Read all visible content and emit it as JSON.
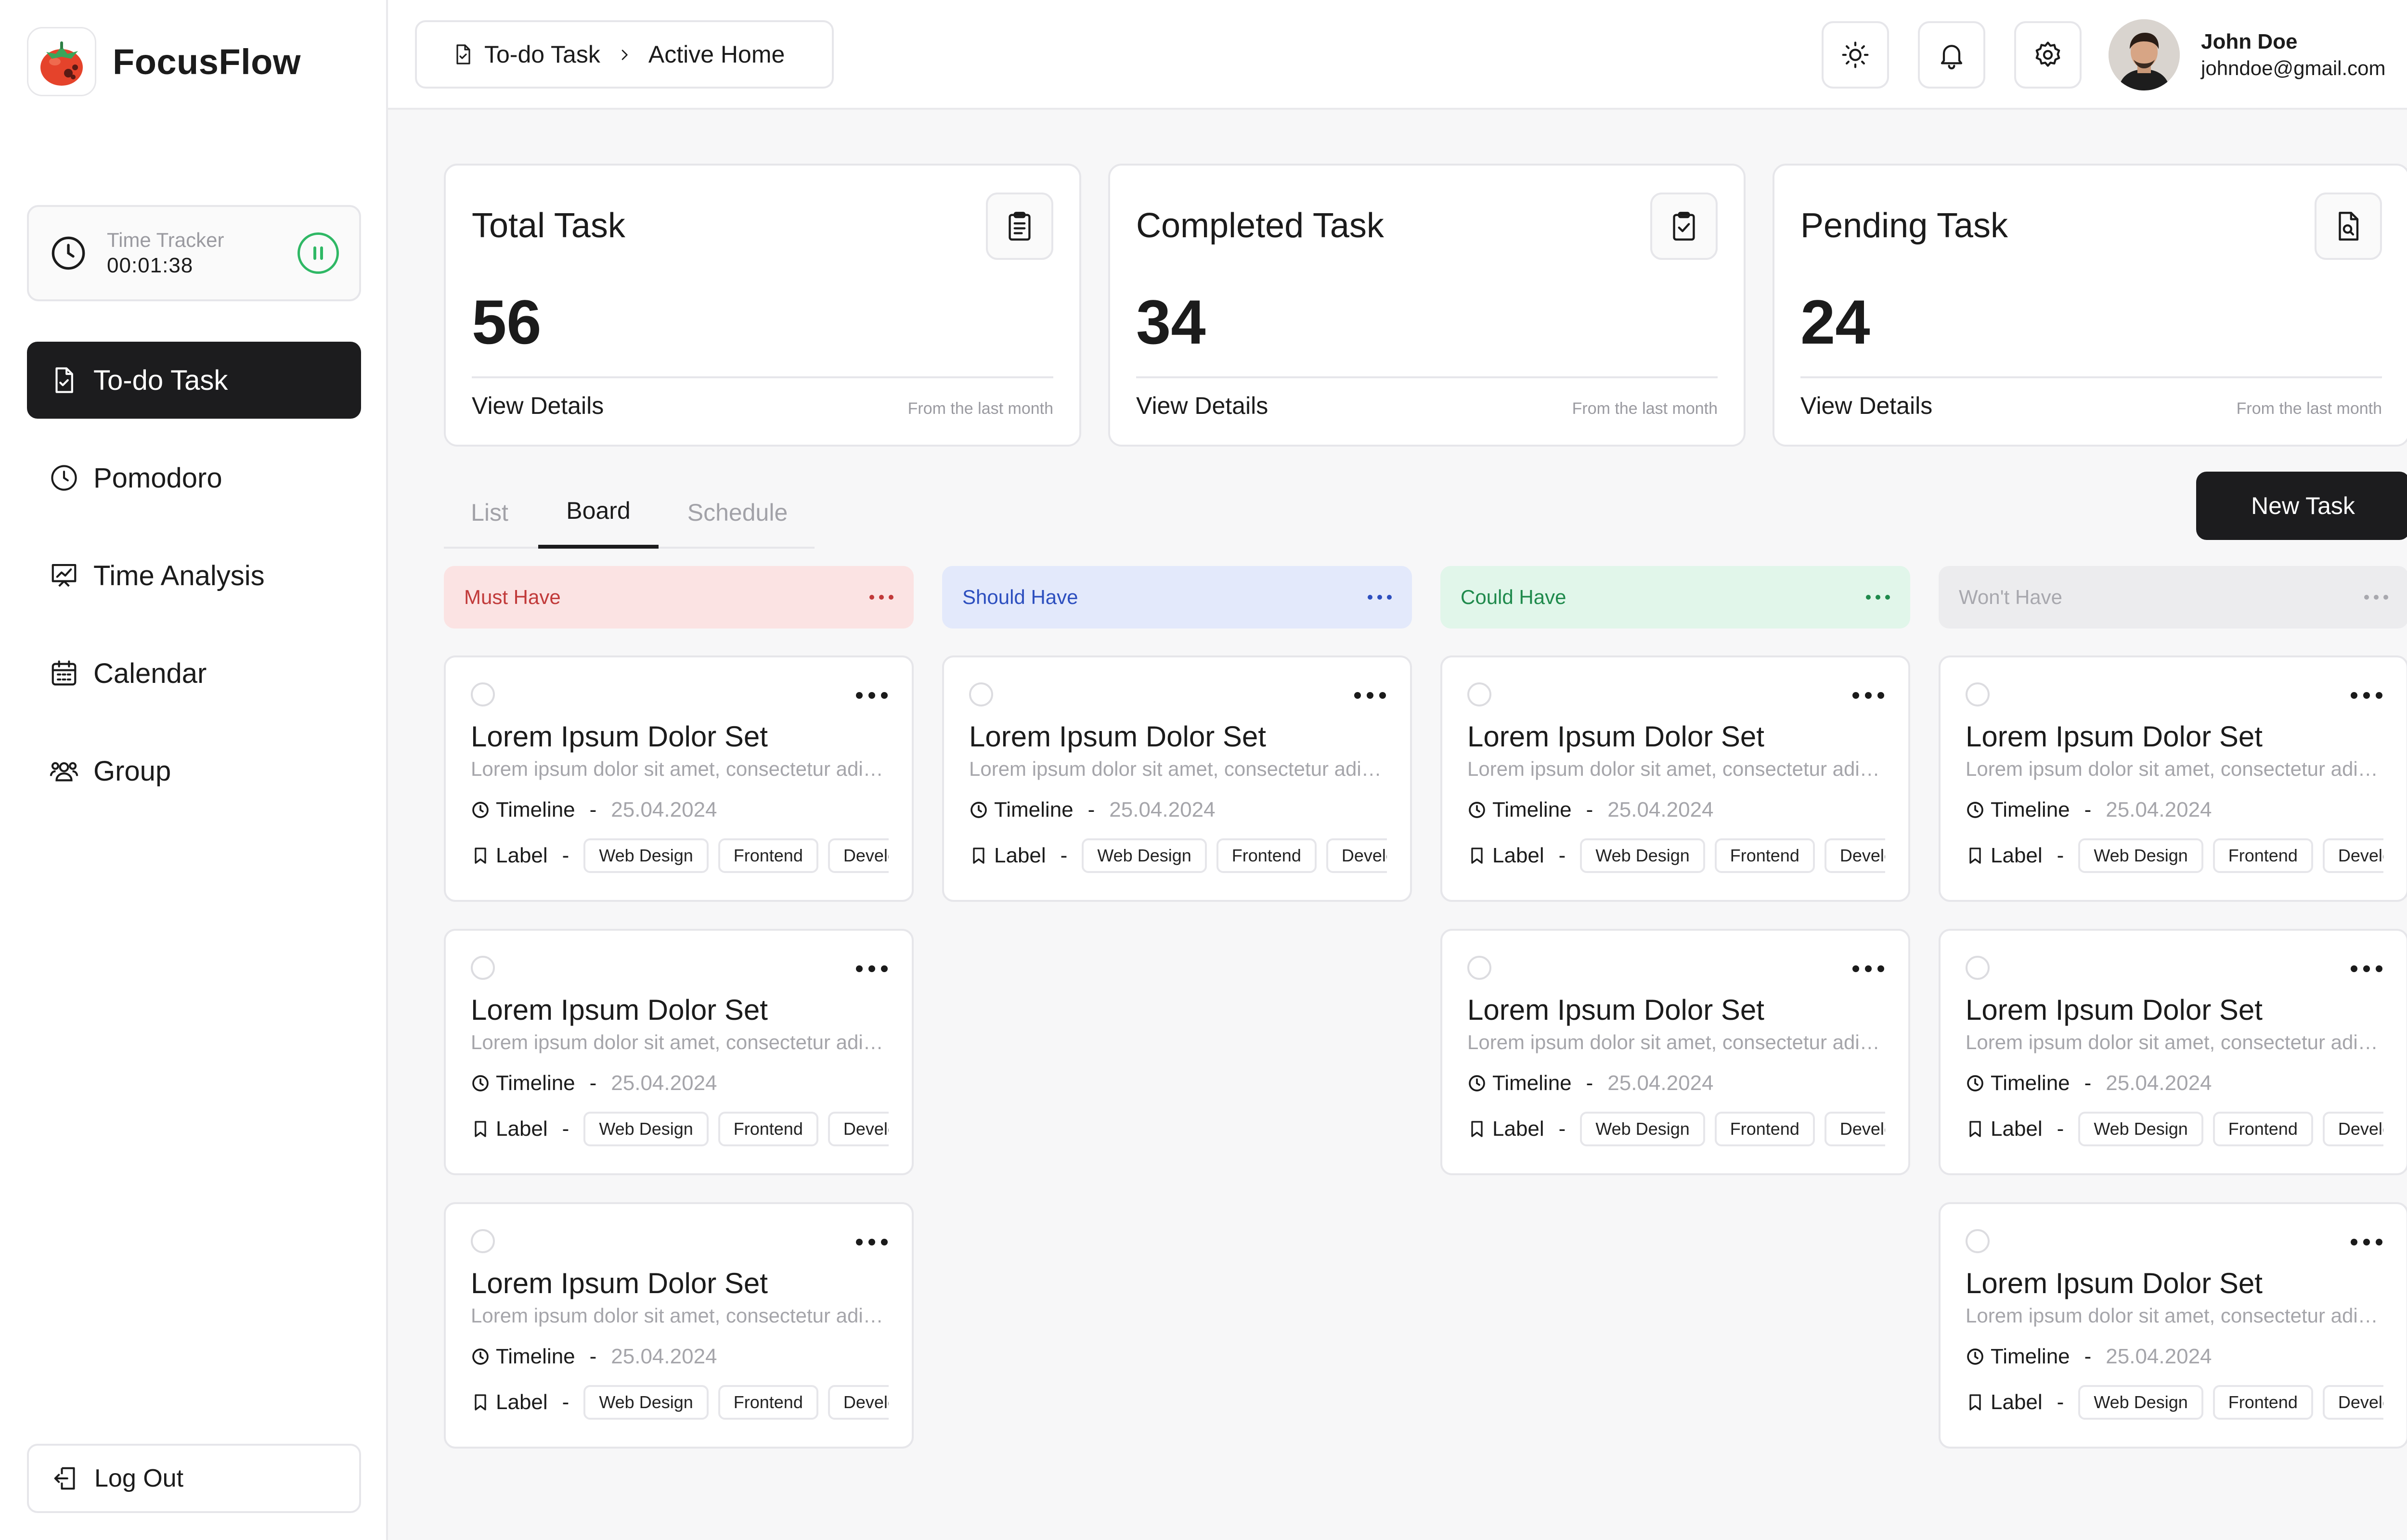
{
  "brand": {
    "name": "FocusFlow"
  },
  "tracker": {
    "label": "Time Tracker",
    "time": "00:01:38"
  },
  "nav": [
    {
      "label": "To-do Task",
      "icon": "file-check-icon",
      "active": true
    },
    {
      "label": "Pomodoro",
      "icon": "clock-icon",
      "active": false
    },
    {
      "label": "Time Analysis",
      "icon": "presentation-chart-icon",
      "active": false
    },
    {
      "label": "Calendar",
      "icon": "calendar-icon",
      "active": false
    },
    {
      "label": "Group",
      "icon": "users-icon",
      "active": false
    }
  ],
  "logout": {
    "label": "Log Out"
  },
  "breadcrumb": {
    "first": "To-do Task",
    "second": "Active Home"
  },
  "user": {
    "name": "John Doe",
    "email": "johndoe@gmail.com"
  },
  "stats": [
    {
      "title": "Total Task",
      "value": "56",
      "link": "View Details",
      "note": "From the last month",
      "icon": "clipboard-list-icon"
    },
    {
      "title": "Completed Task",
      "value": "34",
      "link": "View Details",
      "note": "From the last month",
      "icon": "clipboard-check-icon"
    },
    {
      "title": "Pending Task",
      "value": "24",
      "link": "View Details",
      "note": "From the last month",
      "icon": "file-search-icon"
    }
  ],
  "tabs": [
    "List",
    "Board",
    "Schedule"
  ],
  "active_tab": "Board",
  "new_task": "New Task",
  "card": {
    "title": "Lorem Ipsum Dolor Set",
    "desc": "Lorem ipsum dolor sit amet, consectetur adipiscing elit",
    "timeline_label": "Timeline",
    "dash": "-",
    "date": "25.04.2024",
    "label_label": "Label",
    "chips": [
      "Web Design",
      "Frontend",
      "Develop"
    ]
  },
  "columns": [
    {
      "name": "Must Have",
      "bg": "#fbe3e3",
      "fg": "#c13a3a",
      "cards": 3
    },
    {
      "name": "Should Have",
      "bg": "#e3e9fb",
      "fg": "#2d4fbf",
      "cards": 1
    },
    {
      "name": "Could Have",
      "bg": "#e1f6ea",
      "fg": "#1f8a4c",
      "cards": 2
    },
    {
      "name": "Won't Have",
      "bg": "#ececee",
      "fg": "#a8a8ae",
      "cards": 3
    }
  ]
}
